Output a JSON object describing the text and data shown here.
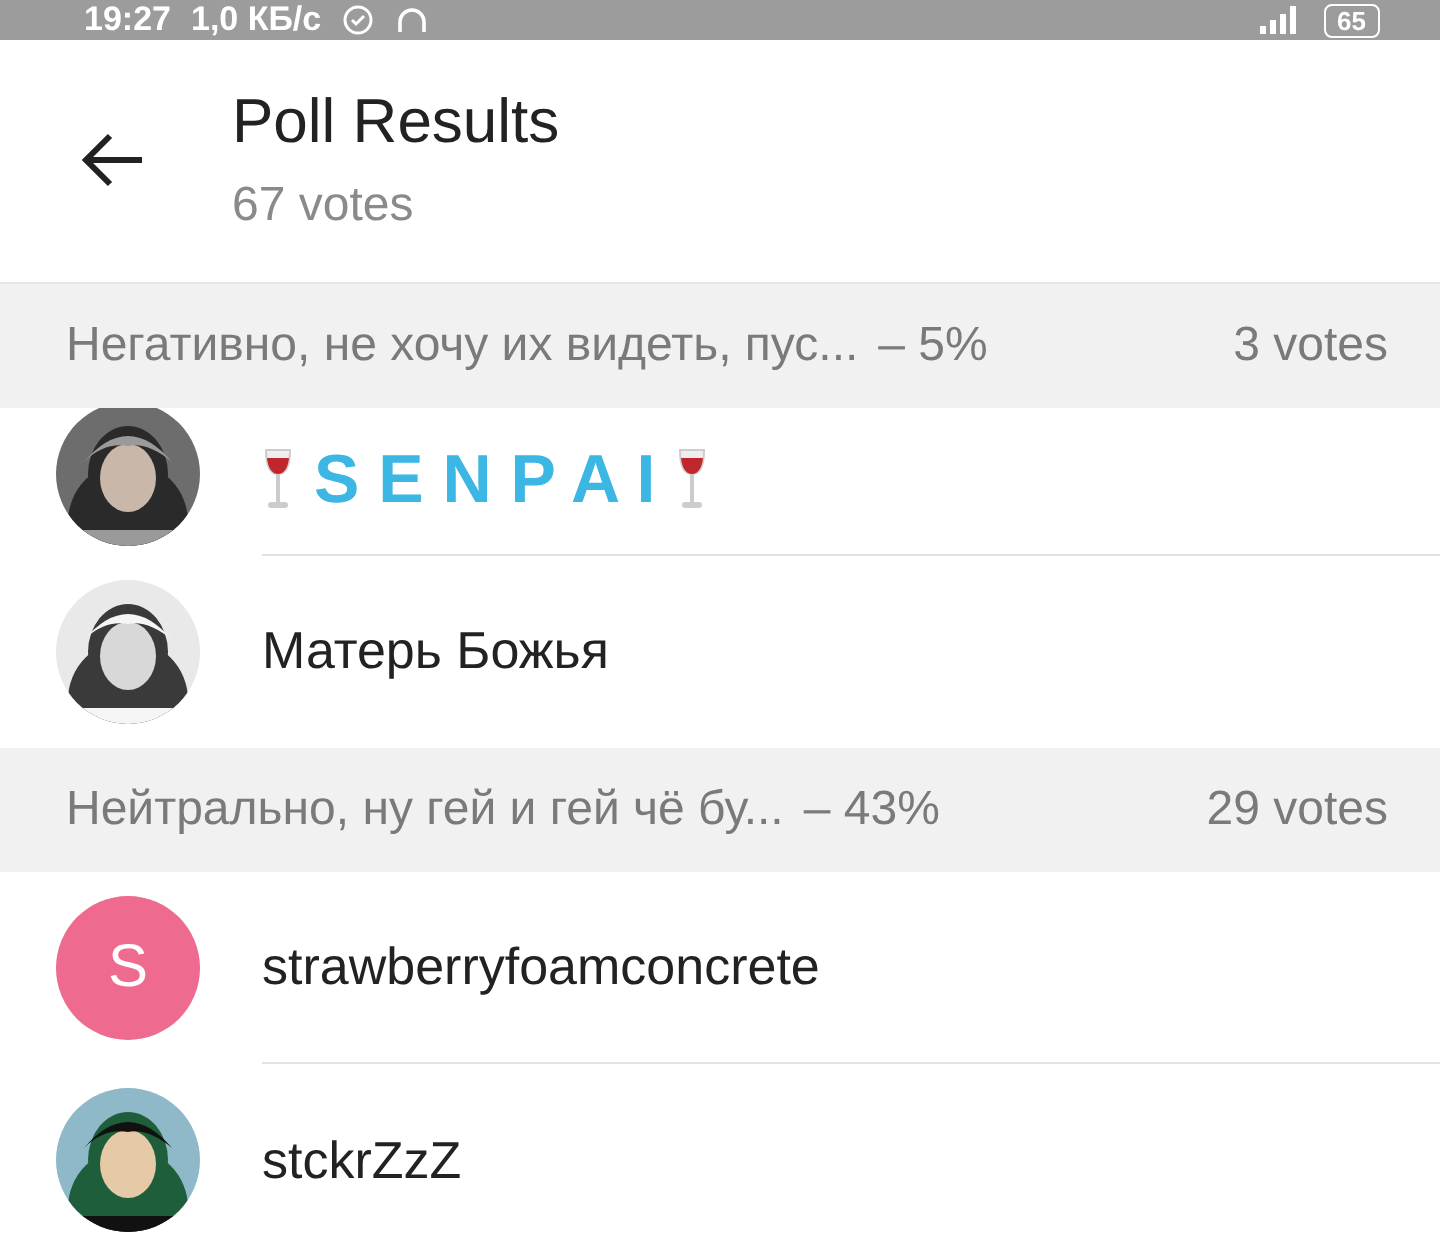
{
  "status_bar": {
    "time": "19:27",
    "speed": "1,0 КБ/с",
    "battery": "65"
  },
  "header": {
    "title": "Poll Results",
    "subtitle": "67 votes"
  },
  "sections": [
    {
      "label": "Негативно, не хочу их видеть, пус...",
      "percent": "– 5%",
      "votes": "3 votes",
      "voters": [
        {
          "name": "S E N P A I",
          "kind": "fancy"
        },
        {
          "name": "Матерь Божья",
          "kind": "plain"
        }
      ]
    },
    {
      "label": "Нейтрально, ну гей и гей чё бу...",
      "percent": "– 43%",
      "votes": "29 votes",
      "voters": [
        {
          "name": "strawberryfoamconcrete",
          "kind": "plain",
          "avatar": {
            "kind": "letter",
            "letter": "S",
            "color": "#ee6a8e"
          }
        },
        {
          "name": "stckrZzZ",
          "kind": "plain"
        }
      ]
    }
  ]
}
